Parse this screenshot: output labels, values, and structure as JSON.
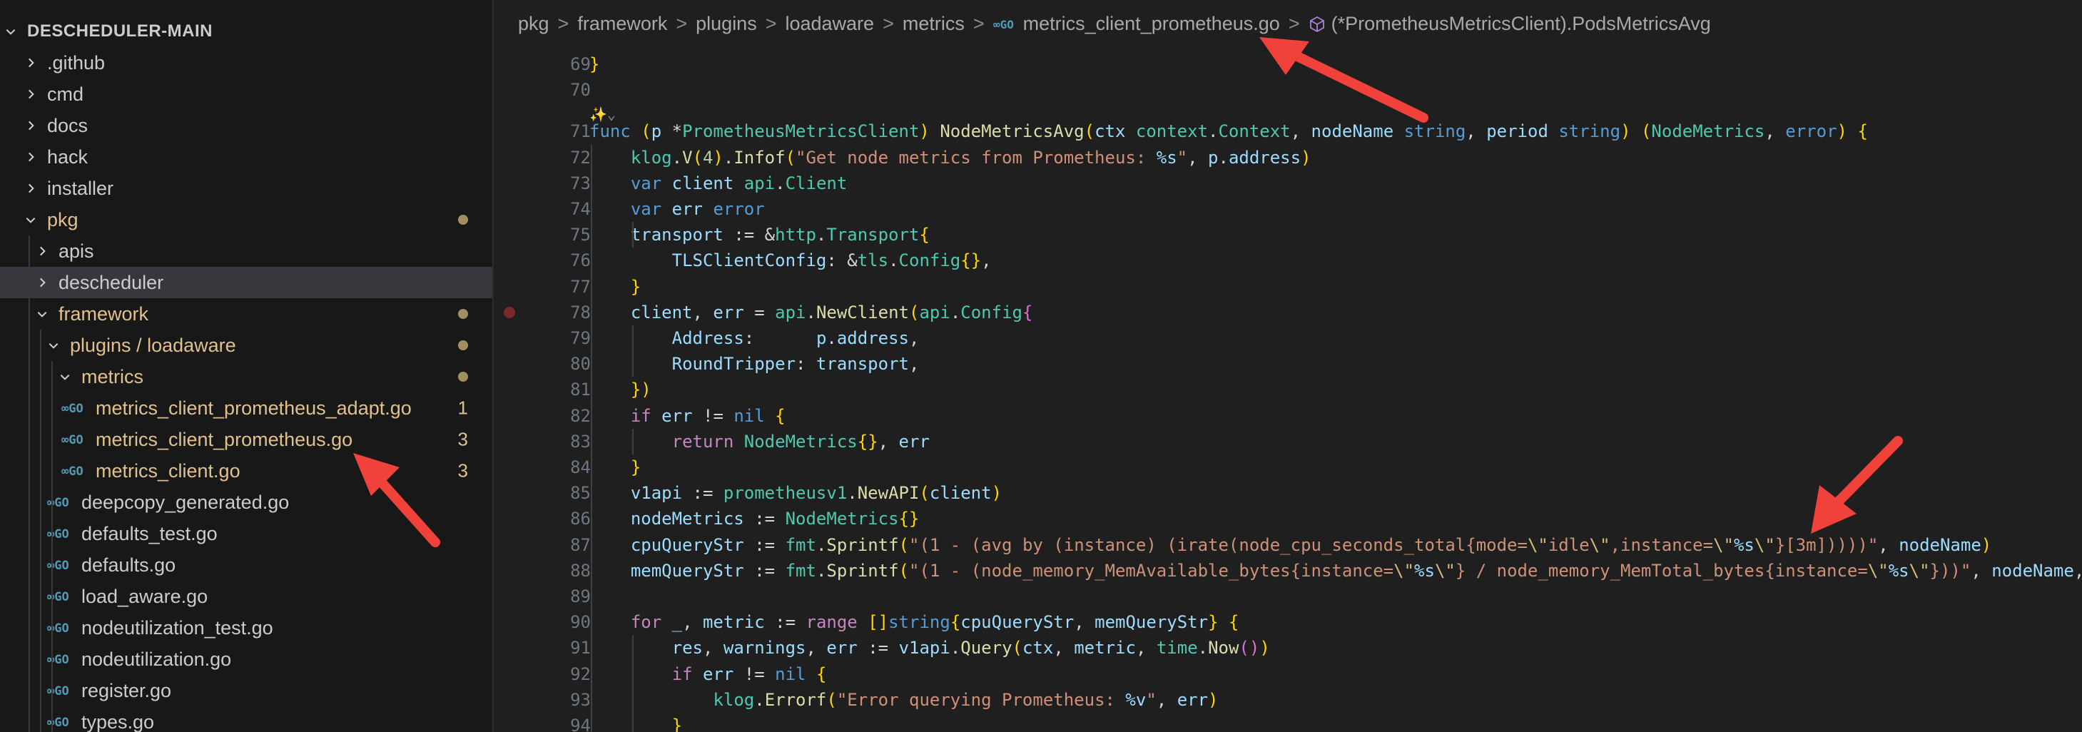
{
  "explorer": {
    "root": "DESCHEDULER-MAIN",
    "items": [
      {
        "label": ".github",
        "kind": "folder",
        "state": "collapsed",
        "depth": 1
      },
      {
        "label": "cmd",
        "kind": "folder",
        "state": "collapsed",
        "depth": 1
      },
      {
        "label": "docs",
        "kind": "folder",
        "state": "collapsed",
        "depth": 1
      },
      {
        "label": "hack",
        "kind": "folder",
        "state": "collapsed",
        "depth": 1
      },
      {
        "label": "installer",
        "kind": "folder",
        "state": "collapsed",
        "depth": 1
      },
      {
        "label": "pkg",
        "kind": "folder",
        "state": "expanded",
        "depth": 1,
        "modified": true
      },
      {
        "label": "apis",
        "kind": "folder",
        "state": "collapsed",
        "depth": 2
      },
      {
        "label": "descheduler",
        "kind": "folder",
        "state": "collapsed",
        "depth": 2,
        "selected": true
      },
      {
        "label": "framework",
        "kind": "folder",
        "state": "expanded",
        "depth": 2,
        "modified": true
      },
      {
        "label": "plugins / loadaware",
        "kind": "folder",
        "state": "expanded",
        "depth": 3,
        "modified": true
      },
      {
        "label": "metrics",
        "kind": "folder",
        "state": "expanded",
        "depth": 4,
        "modified": true
      },
      {
        "label": "metrics_client_prometheus_adapt.go",
        "kind": "go",
        "depth": 5,
        "badge": "1"
      },
      {
        "label": "metrics_client_prometheus.go",
        "kind": "go",
        "depth": 5,
        "badge": "3"
      },
      {
        "label": "metrics_client.go",
        "kind": "go",
        "depth": 5,
        "badge": "3"
      },
      {
        "label": "deepcopy_generated.go",
        "kind": "go",
        "depth": 4
      },
      {
        "label": "defaults_test.go",
        "kind": "go",
        "depth": 4
      },
      {
        "label": "defaults.go",
        "kind": "go",
        "depth": 4
      },
      {
        "label": "load_aware.go",
        "kind": "go",
        "depth": 4
      },
      {
        "label": "nodeutilization_test.go",
        "kind": "go",
        "depth": 4
      },
      {
        "label": "nodeutilization.go",
        "kind": "go",
        "depth": 4
      },
      {
        "label": "register.go",
        "kind": "go",
        "depth": 4
      },
      {
        "label": "types.go",
        "kind": "go",
        "depth": 4
      }
    ]
  },
  "breadcrumb": {
    "parts": [
      "pkg",
      "framework",
      "plugins",
      "loadaware",
      "metrics"
    ],
    "file": "metrics_client_prometheus.go",
    "symbol": "(*PrometheusMetricsClient).PodsMetricsAvg",
    "separator": ">"
  },
  "editor": {
    "ai_hint": "✨⌄",
    "breakpoint_line": "78",
    "lines": [
      {
        "n": "69",
        "text": "}"
      },
      {
        "n": "70",
        "text": ""
      },
      {
        "n": "71",
        "text": "func (p *PrometheusMetricsClient) NodeMetricsAvg(ctx context.Context, nodeName string, period string) (NodeMetrics, error) {"
      },
      {
        "n": "72",
        "text": "    klog.V(4).Infof(\"Get node metrics from Prometheus: %s\", p.address)"
      },
      {
        "n": "73",
        "text": "    var client api.Client"
      },
      {
        "n": "74",
        "text": "    var err error"
      },
      {
        "n": "75",
        "text": "    transport := &http.Transport{"
      },
      {
        "n": "76",
        "text": "        TLSClientConfig: &tls.Config{},"
      },
      {
        "n": "77",
        "text": "    }"
      },
      {
        "n": "78",
        "text": "    client, err = api.NewClient(api.Config{"
      },
      {
        "n": "79",
        "text": "        Address:      p.address,"
      },
      {
        "n": "80",
        "text": "        RoundTripper: transport,"
      },
      {
        "n": "81",
        "text": "    })"
      },
      {
        "n": "82",
        "text": "    if err != nil {"
      },
      {
        "n": "83",
        "text": "        return NodeMetrics{}, err"
      },
      {
        "n": "84",
        "text": "    }"
      },
      {
        "n": "85",
        "text": "    v1api := prometheusv1.NewAPI(client)"
      },
      {
        "n": "86",
        "text": "    nodeMetrics := NodeMetrics{}"
      },
      {
        "n": "87",
        "text": "    cpuQueryStr := fmt.Sprintf(\"(1 - (avg by (instance) (irate(node_cpu_seconds_total{mode=\\\"idle\\\",instance=\\\"%s\\\"}[3m]))))\", nodeName)"
      },
      {
        "n": "88",
        "text": "    memQueryStr := fmt.Sprintf(\"(1 - (node_memory_MemAvailable_bytes{instance=\\\"%s\\\"} / node_memory_MemTotal_bytes{instance=\\\"%s\\\"}))\", nodeName,"
      },
      {
        "n": "89",
        "text": ""
      },
      {
        "n": "90",
        "text": "    for _, metric := range []string{cpuQueryStr, memQueryStr} {"
      },
      {
        "n": "91",
        "text": "        res, warnings, err := v1api.Query(ctx, metric, time.Now())"
      },
      {
        "n": "92",
        "text": "        if err != nil {"
      },
      {
        "n": "93",
        "text": "            klog.Errorf(\"Error querying Prometheus: %v\", err)"
      },
      {
        "n": "94",
        "text": "        }"
      }
    ]
  },
  "colors": {
    "background": "#1f1f1f",
    "sidebar": "#181818",
    "selected_row": "#37373d",
    "modified_text": "#e2c08d",
    "go_icon": "#519aba",
    "annotation_arrow": "#f0413a"
  }
}
